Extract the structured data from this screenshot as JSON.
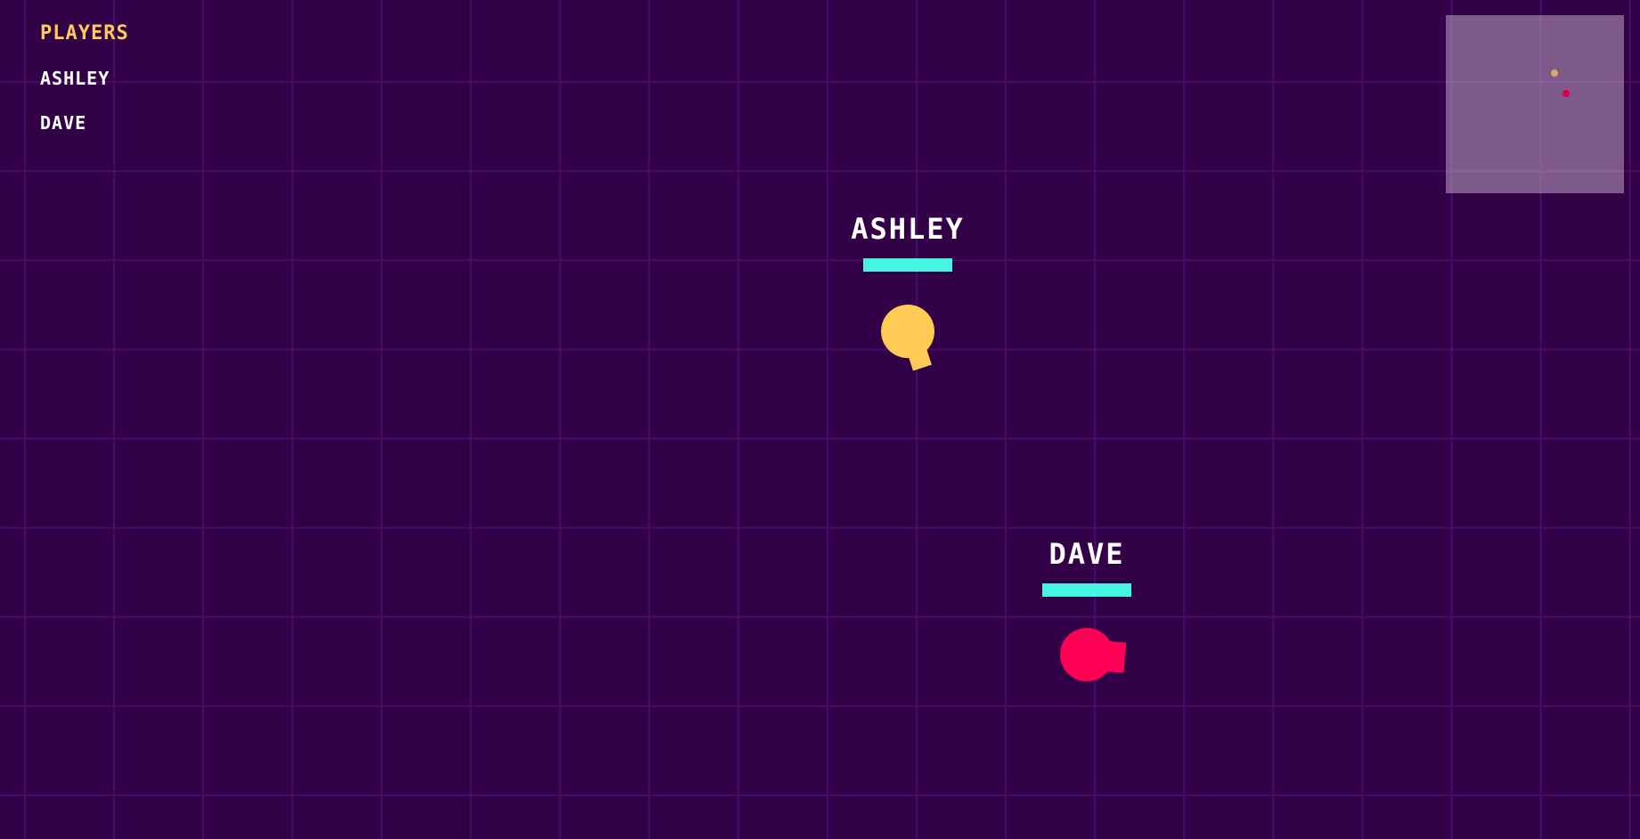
{
  "scoreboard": {
    "header": "PLAYERS",
    "players": [
      "ASHLEY",
      "DAVE"
    ]
  },
  "players": [
    {
      "name": "ASHLEY",
      "color": "#ffcb54",
      "health": 1.0
    },
    {
      "name": "DAVE",
      "color": "#ff0055",
      "health": 1.0
    }
  ],
  "colors": {
    "background": "#310047",
    "grid": "#4a0a6b",
    "health_bar": "#45f5e0",
    "minimap": "rgba(220,200,220,0.45)"
  },
  "icons": {
    "player_token": "tank-circle-with-barrel"
  }
}
